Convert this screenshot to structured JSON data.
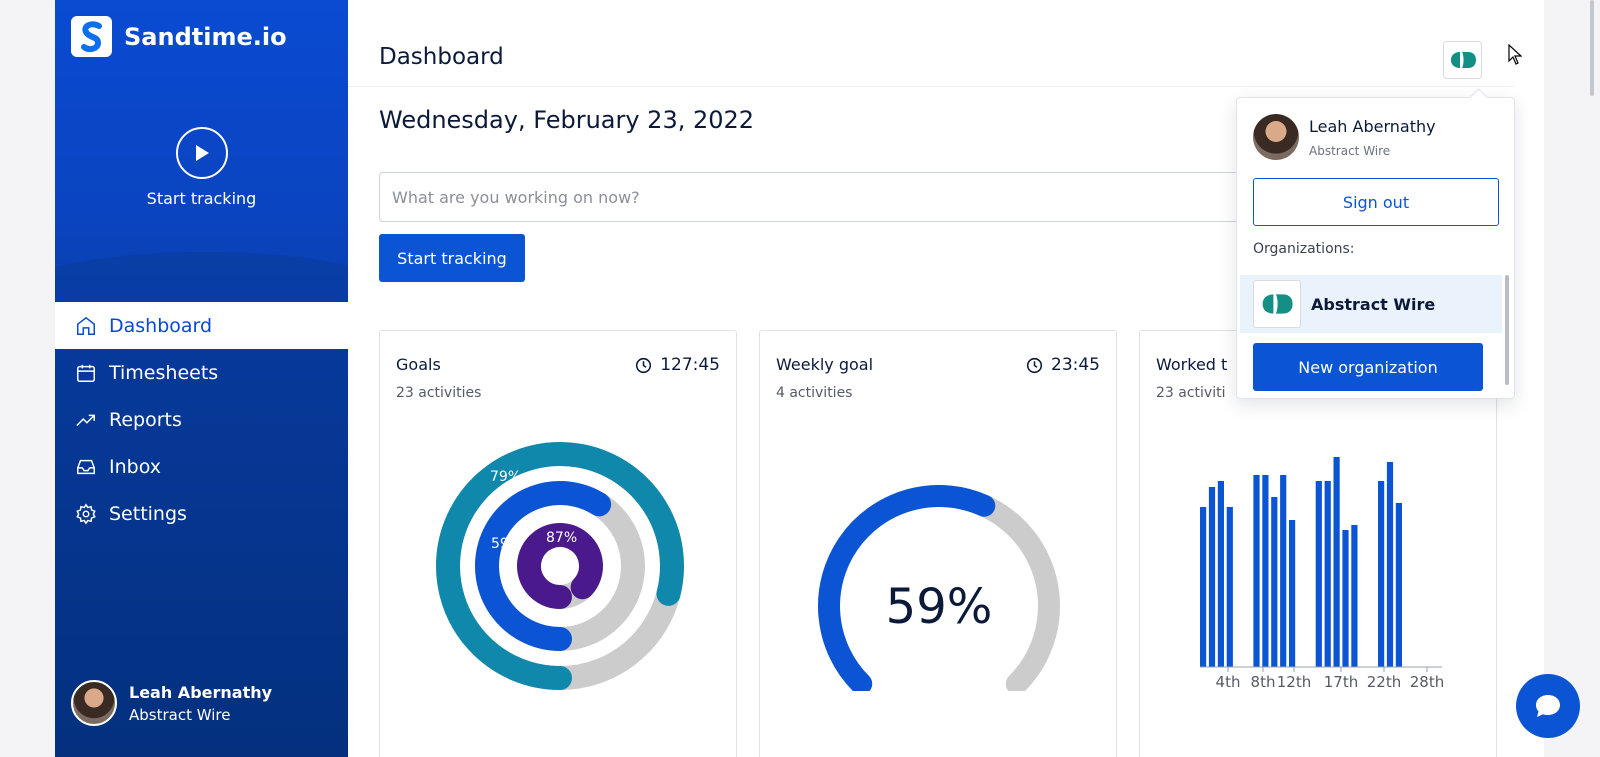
{
  "brand": {
    "name": "Sandtime.io"
  },
  "sidebar": {
    "hero_action": "Start tracking",
    "items": [
      {
        "label": "Dashboard",
        "icon": "home-icon",
        "active": true
      },
      {
        "label": "Timesheets",
        "icon": "calendar-icon"
      },
      {
        "label": "Reports",
        "icon": "trending-up-icon"
      },
      {
        "label": "Inbox",
        "icon": "inbox-icon"
      },
      {
        "label": "Settings",
        "icon": "gear-icon"
      }
    ],
    "user": {
      "name": "Leah Abernathy",
      "org": "Abstract Wire"
    }
  },
  "header": {
    "title": "Dashboard"
  },
  "main": {
    "date": "Wednesday, February 23, 2022",
    "input_placeholder": "What are you working on now?",
    "start_button": "Start tracking"
  },
  "cards": [
    {
      "title": "Goals",
      "subtitle": "23 activities",
      "time": "127:45",
      "rings": [
        {
          "label": "79%",
          "value": 0.79,
          "color": "#1088ac"
        },
        {
          "label": "59%",
          "value": 0.59,
          "color": "#0b55d4"
        },
        {
          "label": "87%",
          "value": 0.87,
          "color": "#4a1a8c"
        }
      ]
    },
    {
      "title": "Weekly goal",
      "subtitle": "4 activities",
      "time": "23:45",
      "gauge": {
        "label": "59%",
        "value": 0.59,
        "color": "#0b55d4"
      }
    },
    {
      "title": "Worked t",
      "subtitle": "23 activiti",
      "bar_ticks": [
        "4th",
        "8th",
        "12th",
        "17th",
        "22th",
        "28th"
      ]
    }
  ],
  "popover": {
    "name": "Leah Abernathy",
    "org": "Abstract Wire",
    "sign_out": "Sign out",
    "organizations_label": "Organizations:",
    "organizations": [
      "Abstract Wire"
    ],
    "new_org": "New organization"
  },
  "colors": {
    "primary": "#0b55d4",
    "teal": "#1088ac",
    "purple": "#4a1a8c",
    "track": "#cccccc",
    "org_logo": "#138f86"
  }
}
